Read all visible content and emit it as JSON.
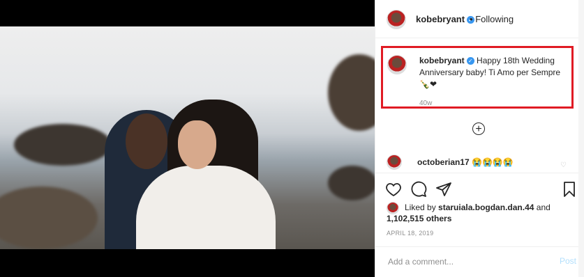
{
  "header": {
    "username": "kobebryant",
    "follow_state": "Following",
    "dot": "•"
  },
  "caption": {
    "username": "kobebryant",
    "text": "Happy 18th Wedding Anniversary baby! Ti Amo per Sempre",
    "emojis": "🍾❤",
    "age": "40w"
  },
  "comments": [
    {
      "username": "octoberian17",
      "text": "😭😭😭😭"
    }
  ],
  "likes": {
    "prefix": "Liked by",
    "user": "staruiala.bogdan.dan.44",
    "middle": "and",
    "count": "1,102,515 others"
  },
  "post_date": "APRIL 18, 2019",
  "add_comment": {
    "placeholder": "Add a comment...",
    "post_label": "Post"
  },
  "icons": {
    "verified": "✓",
    "plus": "+",
    "heart_small": "♡"
  },
  "colors": {
    "highlight": "#e01b24",
    "verified": "#3897f0",
    "post_disabled": "#b2dffc"
  }
}
